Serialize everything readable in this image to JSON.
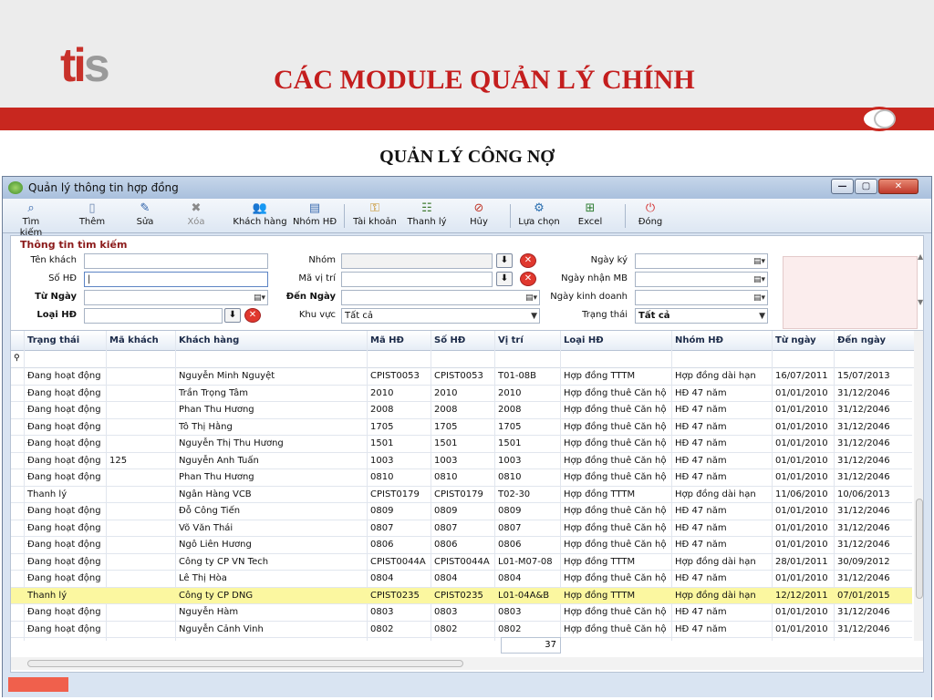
{
  "slide": {
    "title": "CÁC MODULE QUẢN LÝ CHÍNH",
    "subtitle": "QUẢN LÝ CÔNG NỢ",
    "logo_red": "ti",
    "logo_gray": "s",
    "accent_color": "#c8271f"
  },
  "window": {
    "title": "Quản lý thông tin hợp đồng",
    "controls": [
      "minimize-icon",
      "maximize-icon",
      "close-icon"
    ]
  },
  "toolbar": [
    {
      "name": "search",
      "label": "Tìm kiếm",
      "icon": "search-icon",
      "enabled": true
    },
    {
      "name": "add",
      "label": "Thêm",
      "icon": "document-icon",
      "enabled": true
    },
    {
      "name": "edit",
      "label": "Sửa",
      "icon": "edit-icon",
      "enabled": true
    },
    {
      "name": "delete",
      "label": "Xóa",
      "icon": "delete-icon",
      "enabled": false
    },
    {
      "name": "customer",
      "label": "Khách hàng",
      "icon": "users-icon",
      "enabled": true
    },
    {
      "name": "contract-group",
      "label": "Nhóm HĐ",
      "icon": "folder-icon",
      "enabled": true
    },
    {
      "name": "account",
      "label": "Tài khoản",
      "icon": "key-icon",
      "enabled": true
    },
    {
      "name": "liquidate",
      "label": "Thanh lý",
      "icon": "checklist-icon",
      "enabled": true
    },
    {
      "name": "cancel",
      "label": "Hủy",
      "icon": "cancel-icon",
      "enabled": true
    },
    {
      "name": "select",
      "label": "Lựa chọn",
      "icon": "gears-icon",
      "enabled": true
    },
    {
      "name": "excel",
      "label": "Excel",
      "icon": "excel-icon",
      "enabled": true
    },
    {
      "name": "close",
      "label": "Đóng",
      "icon": "power-icon",
      "enabled": true
    }
  ],
  "search": {
    "heading": "Thông tin tìm kiếm",
    "customer_name_label": "Tên khách",
    "customer_name_value": "",
    "contract_no_label": "Số HĐ",
    "contract_no_value": "|",
    "from_date_label": "Từ Ngày",
    "contract_type_label": "Loại HĐ",
    "group_label": "Nhóm",
    "position_label": "Mã vị trí",
    "to_date_label": "Đến Ngày",
    "area_label": "Khu vực",
    "area_value": "Tất cả",
    "sign_date_label": "Ngày ký",
    "receive_date_label": "Ngày nhận MB",
    "business_date_label": "Ngày kinh doanh",
    "status_label": "Trạng thái",
    "status_value": "Tất cả"
  },
  "table": {
    "columns": [
      "Trạng thái",
      "Mã khách",
      "Khách hàng",
      "Mã HĐ",
      "Số HĐ",
      "Vị trí",
      "Loại HĐ",
      "Nhóm HĐ",
      "Từ ngày",
      "Đến ngày"
    ],
    "filter_icon": "pin-icon",
    "rows": [
      [
        "Đang hoạt động",
        "",
        "Nguyễn Minh Nguyệt",
        "CPIST0053",
        "CPIST0053",
        "T01-08B",
        "Hợp đồng TTTM",
        "Hợp đồng dài hạn",
        "16/07/2011",
        "15/07/2013"
      ],
      [
        "Đang hoạt động",
        "",
        "Trần Trọng Tâm",
        "2010",
        "2010",
        "2010",
        "Hợp đồng thuê Căn hộ",
        "HĐ 47 năm",
        "01/01/2010",
        "31/12/2046"
      ],
      [
        "Đang hoạt động",
        "",
        "Phan Thu Hương",
        "2008",
        "2008",
        "2008",
        "Hợp đồng thuê Căn hộ",
        "HĐ 47 năm",
        "01/01/2010",
        "31/12/2046"
      ],
      [
        "Đang hoạt động",
        "",
        "Tô Thị Hằng",
        "1705",
        "1705",
        "1705",
        "Hợp đồng thuê Căn hộ",
        "HĐ 47 năm",
        "01/01/2010",
        "31/12/2046"
      ],
      [
        "Đang hoạt động",
        "",
        "Nguyễn Thị Thu Hương",
        "1501",
        "1501",
        "1501",
        "Hợp đồng thuê Căn hộ",
        "HĐ 47 năm",
        "01/01/2010",
        "31/12/2046"
      ],
      [
        "Đang hoạt động",
        "125",
        "Nguyễn Anh Tuấn",
        "1003",
        "1003",
        "1003",
        "Hợp đồng thuê Căn hộ",
        "HĐ 47 năm",
        "01/01/2010",
        "31/12/2046"
      ],
      [
        "Đang hoạt động",
        "",
        "Phan Thu Hương",
        "0810",
        "0810",
        "0810",
        "Hợp đồng thuê Căn hộ",
        "HĐ 47 năm",
        "01/01/2010",
        "31/12/2046"
      ],
      [
        "Thanh lý",
        "",
        "Ngân Hàng VCB",
        "CPIST0179",
        "CPIST0179",
        "T02-30",
        "Hợp đồng TTTM",
        "Hợp đồng dài hạn",
        "11/06/2010",
        "10/06/2013"
      ],
      [
        "Đang hoạt động",
        "",
        "Đỗ Công Tiến",
        "0809",
        "0809",
        "0809",
        "Hợp đồng thuê Căn hộ",
        "HĐ 47 năm",
        "01/01/2010",
        "31/12/2046"
      ],
      [
        "Đang hoạt động",
        "",
        "Võ Văn Thái",
        "0807",
        "0807",
        "0807",
        "Hợp đồng thuê Căn hộ",
        "HĐ 47 năm",
        "01/01/2010",
        "31/12/2046"
      ],
      [
        "Đang hoạt động",
        "",
        "Ngô Liên Hương",
        "0806",
        "0806",
        "0806",
        "Hợp đồng thuê Căn hộ",
        "HĐ 47 năm",
        "01/01/2010",
        "31/12/2046"
      ],
      [
        "Đang hoạt động",
        "",
        "Công ty CP VN Tech",
        "CPIST0044A",
        "CPIST0044A",
        "L01-M07-08",
        "Hợp đồng TTTM",
        "Hợp đồng dài hạn",
        "28/01/2011",
        "30/09/2012"
      ],
      [
        "Đang hoạt động",
        "",
        "Lê Thị Hòa",
        "0804",
        "0804",
        "0804",
        "Hợp đồng thuê Căn hộ",
        "HĐ 47 năm",
        "01/01/2010",
        "31/12/2046"
      ],
      [
        "Thanh lý",
        "",
        "Công ty CP DNG",
        "CPIST0235",
        "CPIST0235",
        "L01-04A&B",
        "Hợp đồng TTTM",
        "Hợp đồng dài hạn",
        "12/12/2011",
        "07/01/2015"
      ],
      [
        "Đang hoạt động",
        "",
        "Nguyễn Hàm",
        "0803",
        "0803",
        "0803",
        "Hợp đồng thuê Căn hộ",
        "HĐ 47 năm",
        "01/01/2010",
        "31/12/2046"
      ],
      [
        "Đang hoạt động",
        "",
        "Nguyễn Cảnh Vinh",
        "0802",
        "0802",
        "0802",
        "Hợp đồng thuê Căn hộ",
        "HĐ 47 năm",
        "01/01/2010",
        "31/12/2046"
      ]
    ],
    "highlighted_row": 13,
    "total_count": "37"
  },
  "status_color": "#f0604c"
}
